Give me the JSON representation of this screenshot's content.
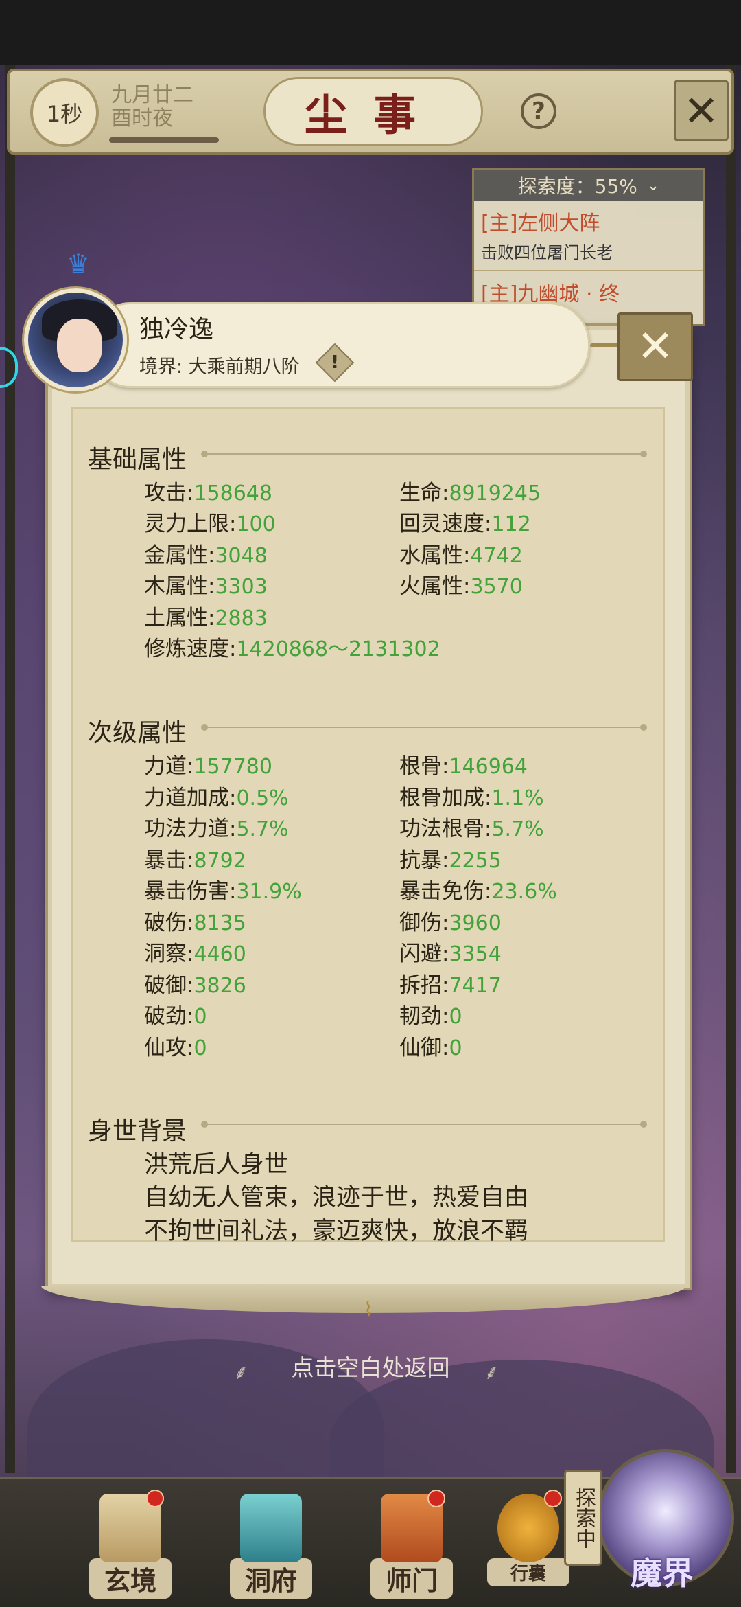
{
  "header": {
    "timer": "1秒",
    "date_line1": "九月廿二",
    "date_line2": "酉时夜",
    "title": "尘事",
    "help_icon": "?"
  },
  "quest_panel": {
    "exploration": "探索度：55%",
    "items": [
      {
        "title": "[主]左侧大阵",
        "desc": "击败四位屠门长老"
      },
      {
        "title": "[主]九幽城 · 终",
        "desc": ""
      }
    ]
  },
  "character": {
    "name": "独冷逸",
    "realm": "境界: 大乘前期八阶"
  },
  "basic": {
    "title": "基础属性",
    "left": [
      {
        "label": "攻击",
        "value": "158648"
      },
      {
        "label": "灵力上限",
        "value": "100"
      },
      {
        "label": "金属性",
        "value": "3048"
      },
      {
        "label": "木属性",
        "value": "3303"
      },
      {
        "label": "土属性",
        "value": "2883"
      },
      {
        "label": "修炼速度",
        "value": "1420868～2131302"
      }
    ],
    "right": [
      {
        "label": "生命",
        "value": "8919245"
      },
      {
        "label": "回灵速度",
        "value": "112"
      },
      {
        "label": "水属性",
        "value": "4742"
      },
      {
        "label": "火属性",
        "value": "3570"
      }
    ]
  },
  "secondary": {
    "title": "次级属性",
    "left": [
      {
        "label": "力道",
        "value": "157780"
      },
      {
        "label": "力道加成",
        "value": "0.5%"
      },
      {
        "label": "功法力道",
        "value": "5.7%"
      },
      {
        "label": "暴击",
        "value": "8792"
      },
      {
        "label": "暴击伤害",
        "value": "31.9%"
      },
      {
        "label": "破伤",
        "value": "8135"
      },
      {
        "label": "洞察",
        "value": "4460"
      },
      {
        "label": "破御",
        "value": "3826"
      },
      {
        "label": "破劲",
        "value": "0"
      },
      {
        "label": "仙攻",
        "value": "0"
      }
    ],
    "right": [
      {
        "label": "根骨",
        "value": "146964"
      },
      {
        "label": "根骨加成",
        "value": "1.1%"
      },
      {
        "label": "功法根骨",
        "value": "5.7%"
      },
      {
        "label": "抗暴",
        "value": "2255"
      },
      {
        "label": "暴击免伤",
        "value": "23.6%"
      },
      {
        "label": "御伤",
        "value": "3960"
      },
      {
        "label": "闪避",
        "value": "3354"
      },
      {
        "label": "拆招",
        "value": "7417"
      },
      {
        "label": "韧劲",
        "value": "0"
      },
      {
        "label": "仙御",
        "value": "0"
      }
    ]
  },
  "background": {
    "title": "身世背景",
    "lines": [
      "洪荒后人身世",
      "自幼无人管束，浪迹于世，热爱自由",
      "不拘世间礼法，豪迈爽快，放浪不羁"
    ]
  },
  "return_hint": "点击空白处返回",
  "nav": {
    "items": [
      "玄境",
      "洞府",
      "师门",
      "行囊"
    ],
    "explore_badge": "探索中",
    "demon": "魔界"
  },
  "colors": {
    "value_green": "#43a23a",
    "title_red": "#7a1f1a",
    "quest_red": "#c24d2c"
  }
}
